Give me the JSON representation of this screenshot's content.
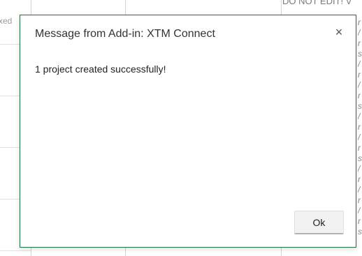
{
  "spreadsheet": {
    "left_cell_fragment": "xed",
    "top_header_fragment": "DO NOT EDIT! V",
    "right_column_fragments": [
      "r",
      "/",
      "r",
      "s",
      "/",
      "r",
      "/",
      "r",
      "s",
      "/",
      "r",
      "/",
      "r",
      "s",
      "/",
      "r",
      "/",
      "r",
      "/",
      "r",
      "s"
    ]
  },
  "dialog": {
    "title": "Message from Add-in: XTM Connect",
    "close_glyph": "×",
    "close_icon": "close-icon",
    "message": "1 project created successfully!",
    "ok_label": "Ok"
  },
  "colors": {
    "dialog_border": "#217346",
    "grid_line": "#d4d4d4",
    "button_bg": "#f2f2f2"
  }
}
